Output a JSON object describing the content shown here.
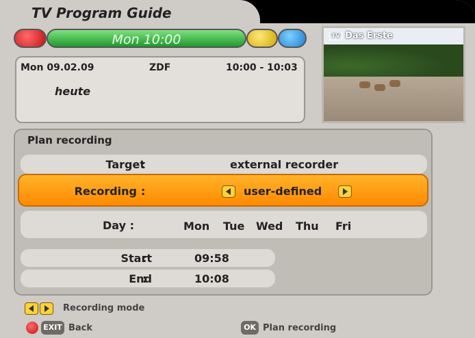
{
  "header": {
    "title": "TV Program Guide"
  },
  "color_bar": {
    "time_label": "Mon 10:00",
    "colors": {
      "red": "#c41414",
      "green": "#1f9a2e",
      "yellow": "#d0a800",
      "blue": "#1f7fd0"
    }
  },
  "event": {
    "date": "Mon  09.02.09",
    "channel": "ZDF",
    "time": "10:00 - 10:03",
    "title": "heute"
  },
  "preview": {
    "channel": "Das Erste",
    "badge": "TV"
  },
  "plan": {
    "title": "Plan recording",
    "target": {
      "label": "Target",
      "sep": ":",
      "value": "external recorder"
    },
    "recording": {
      "label": "Recording",
      "sep": ":",
      "value": "user-defined",
      "accent": "#ff8a00"
    },
    "day": {
      "label": "Day :",
      "days": [
        "Mon",
        "Tue",
        "Wed",
        "Thu",
        "Fri"
      ]
    },
    "start": {
      "label": "Start",
      "sep": ":",
      "value": "09:58"
    },
    "end": {
      "label": "End",
      "sep": ":",
      "value": "10:08"
    }
  },
  "legend": {
    "recording_mode": "Recording mode",
    "back": "Back",
    "exit_key": "EXIT",
    "ok_key": "OK",
    "plan_recording": "Plan recording"
  }
}
